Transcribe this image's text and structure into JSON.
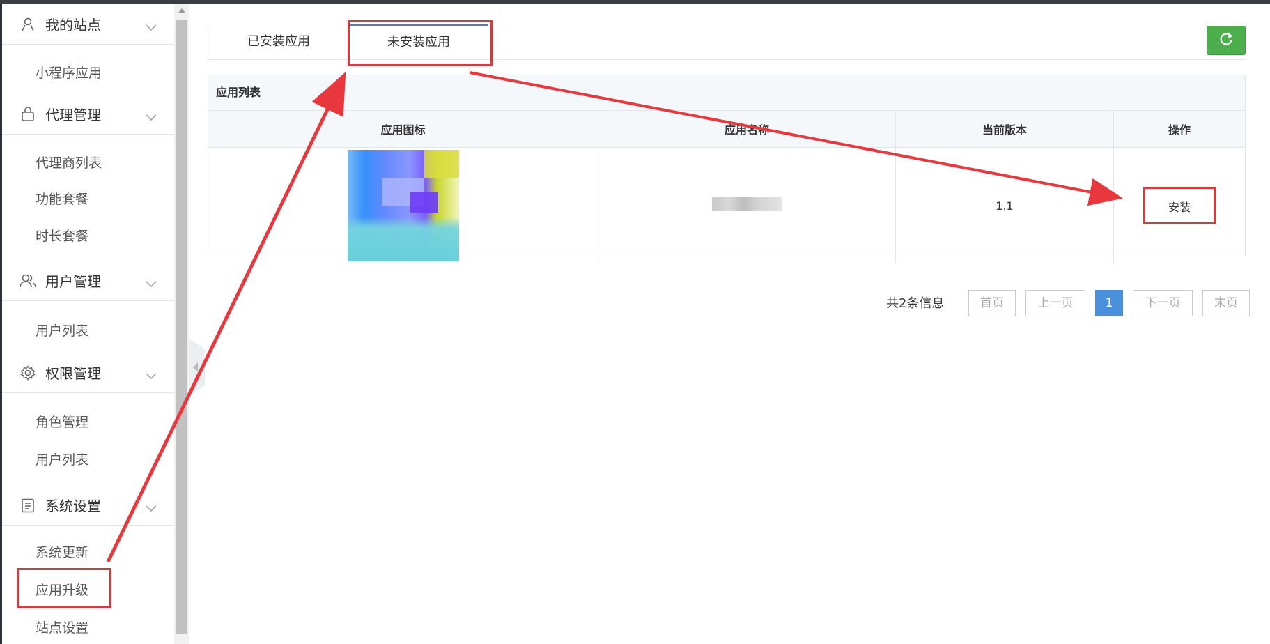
{
  "sidebar": {
    "groups": [
      {
        "icon": "user-icon",
        "title": "我的站点",
        "items": [
          "小程序应用"
        ]
      },
      {
        "icon": "bag-icon",
        "title": "代理管理",
        "items": [
          "代理商列表",
          "功能套餐",
          "时长套餐"
        ]
      },
      {
        "icon": "users-icon",
        "title": "用户管理",
        "items": [
          "用户列表"
        ]
      },
      {
        "icon": "gear-icon",
        "title": "权限管理",
        "items": [
          "角色管理",
          "用户列表"
        ]
      },
      {
        "icon": "clipboard-icon",
        "title": "系统设置",
        "items": [
          "系统更新",
          "应用升级",
          "站点设置"
        ]
      }
    ]
  },
  "tabs": {
    "installed": "已安装应用",
    "not_installed": "未安装应用",
    "active": "not_installed"
  },
  "panel": {
    "title": "应用列表",
    "columns": [
      "应用图标",
      "应用名称",
      "当前版本",
      "操作"
    ],
    "rows": [
      {
        "version": "1.1",
        "action": "安装"
      }
    ]
  },
  "pagination": {
    "total": "共2条信息",
    "first": "首页",
    "prev": "上一页",
    "current": "1",
    "next": "下一页",
    "last": "末页"
  },
  "colors": {
    "accent_green": "#4cae4c",
    "annotation_red": "#e0353b",
    "page_active": "#4a8fdb"
  }
}
